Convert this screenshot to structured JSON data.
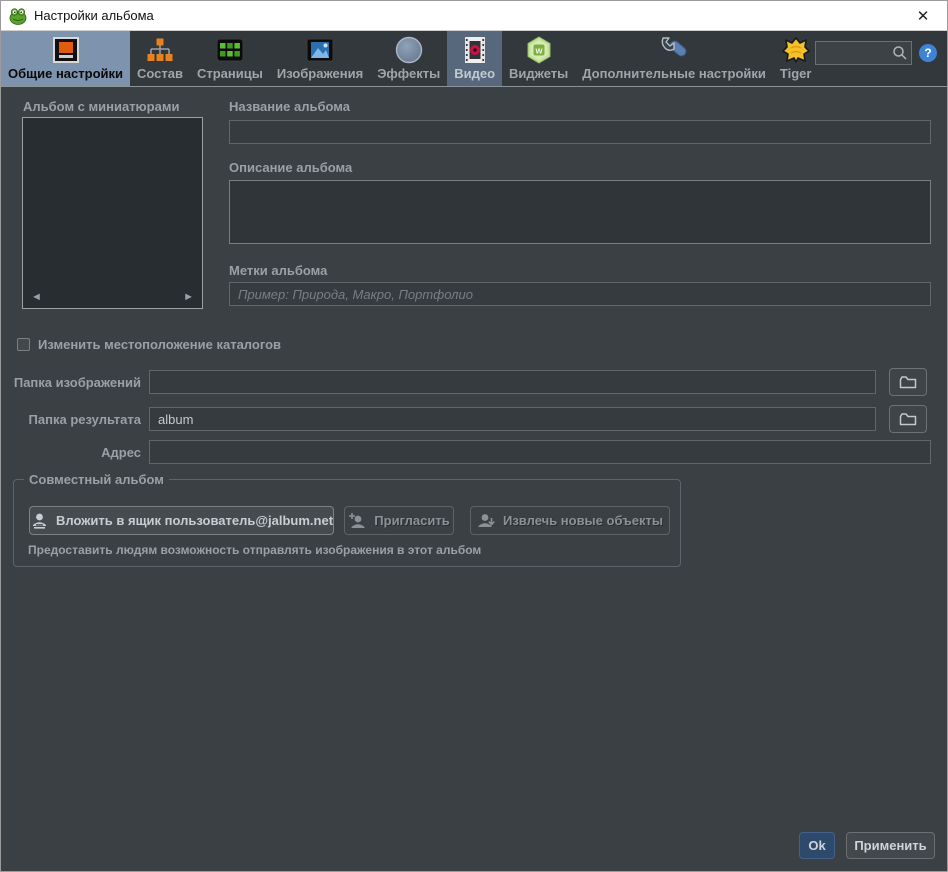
{
  "window": {
    "title": "Настройки альбома",
    "close_glyph": "✕"
  },
  "toolbar": {
    "tabs": [
      {
        "label": "Общие настройки",
        "icon": "general-settings-icon",
        "state": "selected"
      },
      {
        "label": "Состав",
        "icon": "structure-icon",
        "state": "normal"
      },
      {
        "label": "Страницы",
        "icon": "pages-icon",
        "state": "normal"
      },
      {
        "label": "Изображения",
        "icon": "images-icon",
        "state": "normal"
      },
      {
        "label": "Эффекты",
        "icon": "effects-icon",
        "state": "normal"
      },
      {
        "label": "Видео",
        "icon": "video-icon",
        "state": "highlighted"
      },
      {
        "label": "Виджеты",
        "icon": "widgets-icon",
        "state": "normal"
      },
      {
        "label": "Дополнительные настройки",
        "icon": "advanced-settings-icon",
        "state": "normal"
      },
      {
        "label": "Tiger",
        "icon": "tiger-icon",
        "state": "normal"
      }
    ],
    "search": {
      "value": "",
      "placeholder": ""
    },
    "help_glyph": "?"
  },
  "left_panel": {
    "thumbnails_label": "Альбом с миниатюрами",
    "prev_arrow": "◄",
    "next_arrow": "►"
  },
  "fields": {
    "album_name": {
      "label": "Название альбома",
      "value": ""
    },
    "album_description": {
      "label": "Описание альбома",
      "value": ""
    },
    "album_tags": {
      "label": "Метки альбома",
      "value": "",
      "placeholder": "Пример: Природа, Макро, Портфолио"
    },
    "change_location": {
      "label": "Изменить местоположение каталогов",
      "checked": false
    },
    "image_folder": {
      "label": "Папка изображений",
      "value": ""
    },
    "result_folder": {
      "label": "Папка результата",
      "value": "album"
    },
    "address": {
      "label": "Адрес",
      "value": ""
    }
  },
  "shared_album": {
    "legend": "Совместный альбом",
    "buttons": [
      {
        "label": "Вложить в ящик пользователь@jalbum.net",
        "icon": "user-inbox-icon",
        "enabled": true
      },
      {
        "label": "Пригласить",
        "icon": "user-add-icon",
        "enabled": false
      },
      {
        "label": "Извлечь новые объекты",
        "icon": "user-download-icon",
        "enabled": false
      }
    ],
    "caption": "Предоставить людям возможность отправлять изображения в этот альбом"
  },
  "footer": {
    "ok_label": "Ok",
    "apply_label": "Применить"
  },
  "colors": {
    "titlebar_bg": "#ffffff",
    "toolbar_bg": "#33383c",
    "content_bg": "#3b4045",
    "selected_tab_bg": "#7e93ad",
    "highlighted_tab_bg": "#57687d",
    "help_icon_bg": "#3f83d4",
    "ok_button_bg": "#2d4a6d",
    "widget_icon_green": "#b9dc8c",
    "tiger_icon_yellow": "#f5c028",
    "video_icon_red": "#cc1144",
    "structure_icon_orange": "#e8821e"
  }
}
